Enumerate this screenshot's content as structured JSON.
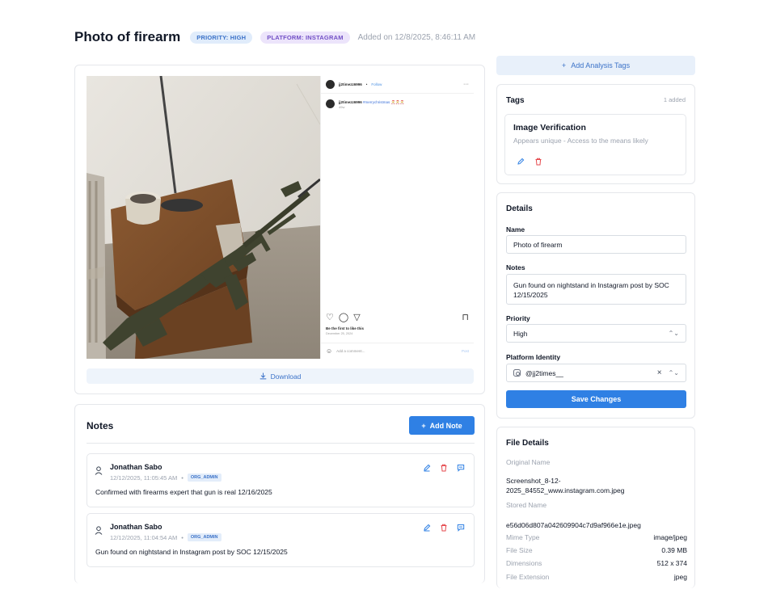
{
  "header": {
    "title": "Photo of firearm",
    "priority_badge": "PRIORITY: HIGH",
    "platform_badge": "PLATFORM: INSTAGRAM",
    "added": "Added on 12/8/2025, 8:46:11 AM"
  },
  "post": {
    "username": "jj2timezz6996",
    "follow": "Follow",
    "more": "···",
    "caption_user": "jj2timezz6996",
    "caption_tag": "#merrychristmas",
    "caption_time": "49w",
    "likes": "Be the first to like this",
    "date": "December 25, 2024",
    "comment_placeholder": "Add a comment...",
    "post_label": "Post"
  },
  "media": {
    "download_label": "Download"
  },
  "notes": {
    "title": "Notes",
    "add_label": "Add Note",
    "items": [
      {
        "author": "Jonathan Sabo",
        "timestamp": "12/12/2025, 11:05:45 AM",
        "role": "ORG_ADMIN",
        "text": "Confirmed with firearms expert that gun is real 12/16/2025"
      },
      {
        "author": "Jonathan Sabo",
        "timestamp": "12/12/2025, 11:04:54 AM",
        "role": "ORG_ADMIN",
        "text": "Gun found on nightstand in Instagram post by SOC 12/15/2025"
      }
    ]
  },
  "sidebar": {
    "add_tags_label": "Add Analysis Tags",
    "tags": {
      "title": "Tags",
      "count": "1 added",
      "items": [
        {
          "name": "Image Verification",
          "desc": "Appears unique - Access to the means likely"
        }
      ]
    },
    "details": {
      "title": "Details",
      "name_label": "Name",
      "name_value": "Photo of firearm",
      "notes_label": "Notes",
      "notes_value": "Gun found on nightstand in Instagram post by SOC 12/15/2025",
      "priority_label": "Priority",
      "priority_value": "High",
      "platform_label": "Platform Identity",
      "platform_value": "@jj2times__",
      "save_label": "Save Changes"
    },
    "file": {
      "title": "File Details",
      "original_label": "Original Name",
      "original_value": "Screenshot_8-12-2025_84552_www.instagram.com.jpeg",
      "stored_label": "Stored Name",
      "stored_value": "e56d06d807a042609904c7d9af966e1e.jpeg",
      "mime_label": "Mime Type",
      "mime_value": "image/jpeg",
      "size_label": "File Size",
      "size_value": "0.39 MB",
      "dim_label": "Dimensions",
      "dim_value": "512 x 374",
      "ext_label": "File Extension",
      "ext_value": "jpeg"
    }
  },
  "icons": {
    "add": "plus-icon",
    "download": "download-icon",
    "user": "user-icon",
    "edit": "edit-icon",
    "delete": "trash-icon",
    "reply": "reply-icon",
    "instagram": "instagram-icon",
    "clear": "close-icon",
    "select": "chevron-updown-icon"
  },
  "colors": {
    "accent": "#2f80e4",
    "accent_light": "#e8f0fa",
    "priority_badge_bg": "#e0ecfb",
    "platform_badge_bg": "#ece4fb",
    "danger": "#e5484d"
  }
}
